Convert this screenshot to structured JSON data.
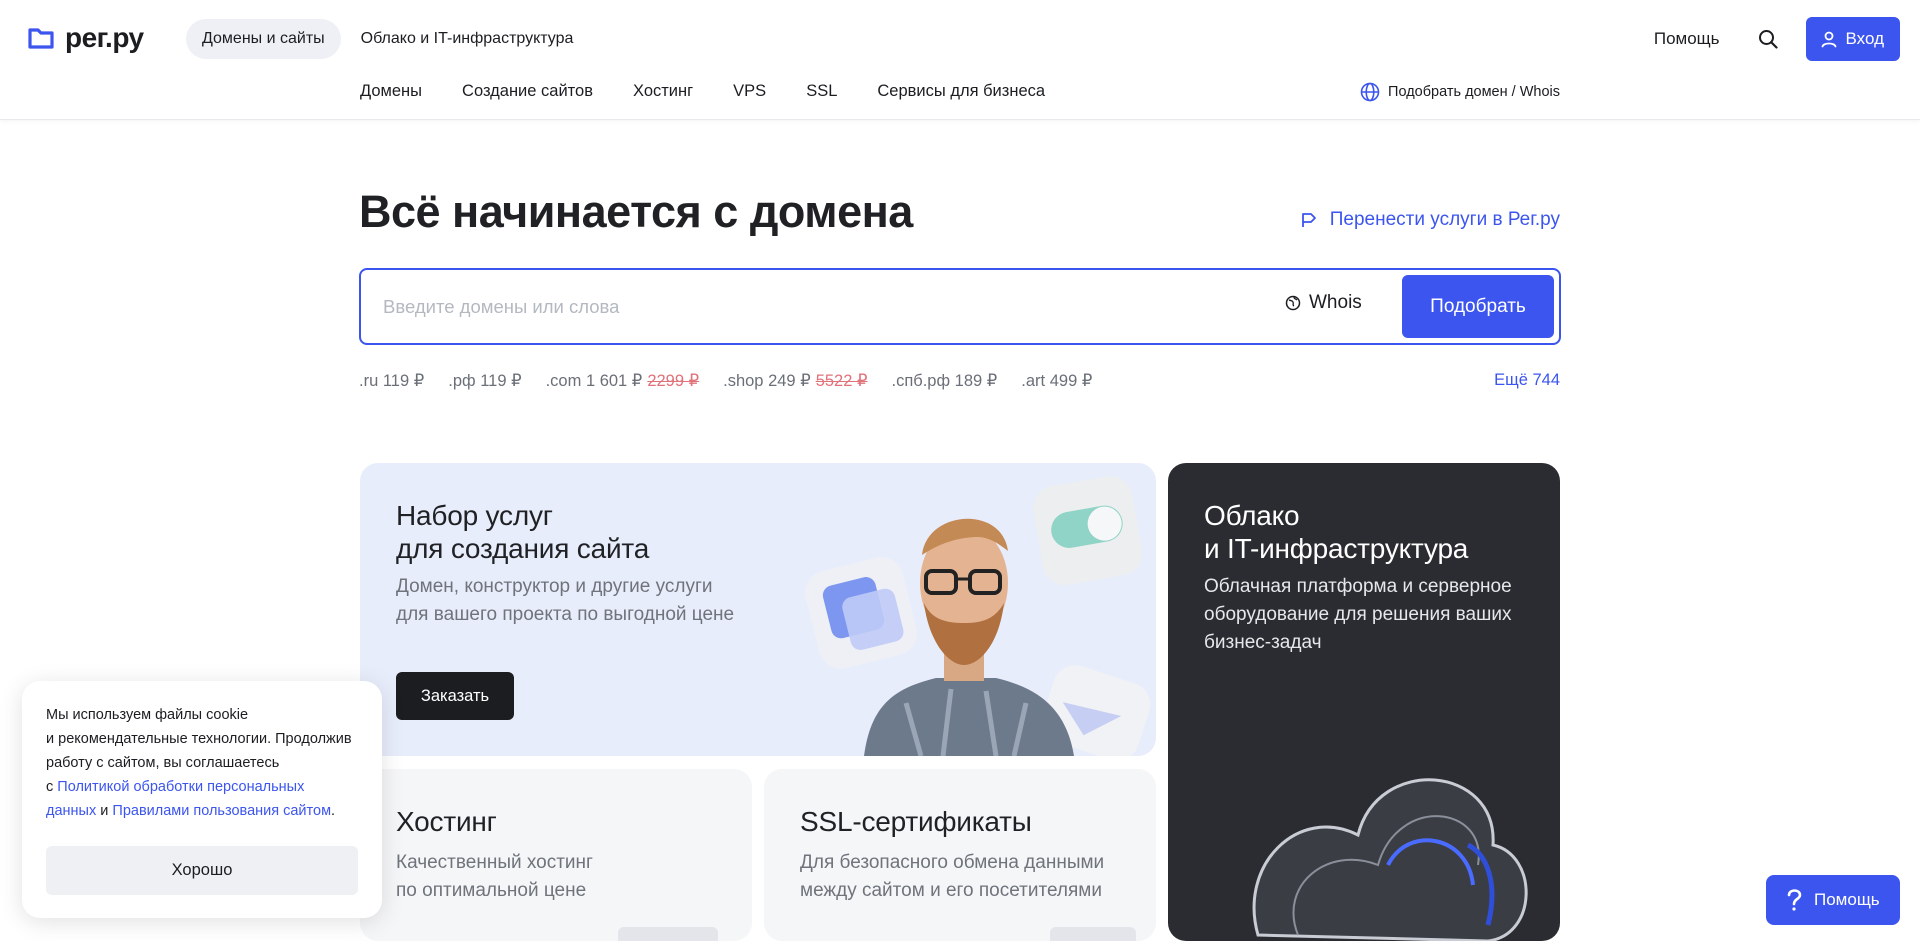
{
  "brand": {
    "name": "рег.ру",
    "accent": "#3c55ee"
  },
  "top_nav": [
    {
      "label": "Домены и сайты",
      "active": true
    },
    {
      "label": "Облако и IT-инфраструктура",
      "active": false
    }
  ],
  "header_right": {
    "help": "Помощь",
    "login": "Вход"
  },
  "sub_nav": [
    "Домены",
    "Создание сайтов",
    "Хостинг",
    "VPS",
    "SSL",
    "Сервисы для бизнеса"
  ],
  "sub_nav_right": "Подобрать домен / Whois",
  "hero": {
    "title": "Всё начинается с домена",
    "transfer_link": "Перенести услуги в Рег.ру",
    "search_placeholder": "Введите домены или слова",
    "whois": "Whois",
    "submit": "Подобрать"
  },
  "prices": [
    {
      "zone": ".ru",
      "price": "119 ₽",
      "old": ""
    },
    {
      "zone": ".рф",
      "price": "119 ₽",
      "old": ""
    },
    {
      "zone": ".com",
      "price": "1 601 ₽",
      "old": "2299 ₽"
    },
    {
      "zone": ".shop",
      "price": "249 ₽",
      "old": "5522 ₽"
    },
    {
      "zone": ".спб.рф",
      "price": "189 ₽",
      "old": ""
    },
    {
      "zone": ".art",
      "price": "499 ₽",
      "old": ""
    }
  ],
  "more_zones": "Ещё 744",
  "cards": {
    "site": {
      "title_l1": "Набор услуг",
      "title_l2": "для создания сайта",
      "desc_l1": "Домен, конструктор и другие услуги",
      "desc_l2": "для вашего проекта по выгодной цене",
      "button": "Заказать"
    },
    "cloud": {
      "title_l1": "Облако",
      "title_l2": "и IT-инфраструктура",
      "desc_l1": "Облачная платформа и серверное",
      "desc_l2": "оборудование для решения ваших",
      "desc_l3": "бизнес-задач"
    },
    "hosting": {
      "title": "Хостинг",
      "desc_l1": "Качественный хостинг",
      "desc_l2": "по оптимальной цене"
    },
    "ssl": {
      "title": "SSL-сертификаты",
      "desc_l1": "Для безопасного обмена данными",
      "desc_l2": "между сайтом и его посетителями"
    }
  },
  "cookie": {
    "l1": "Мы используем файлы cookie",
    "l2": "и рекомендательные технологии. Продолжив",
    "l3": "работу с сайтом, вы соглашаетесь",
    "l4_prefix": "с",
    "policy_l1": "Политикой обработки персональных",
    "policy_l2": "данных",
    "and": "и",
    "rules": "Правилами пользования сайтом",
    "dot": ".",
    "ok": "Хорошо"
  },
  "help_float": "Помощь"
}
